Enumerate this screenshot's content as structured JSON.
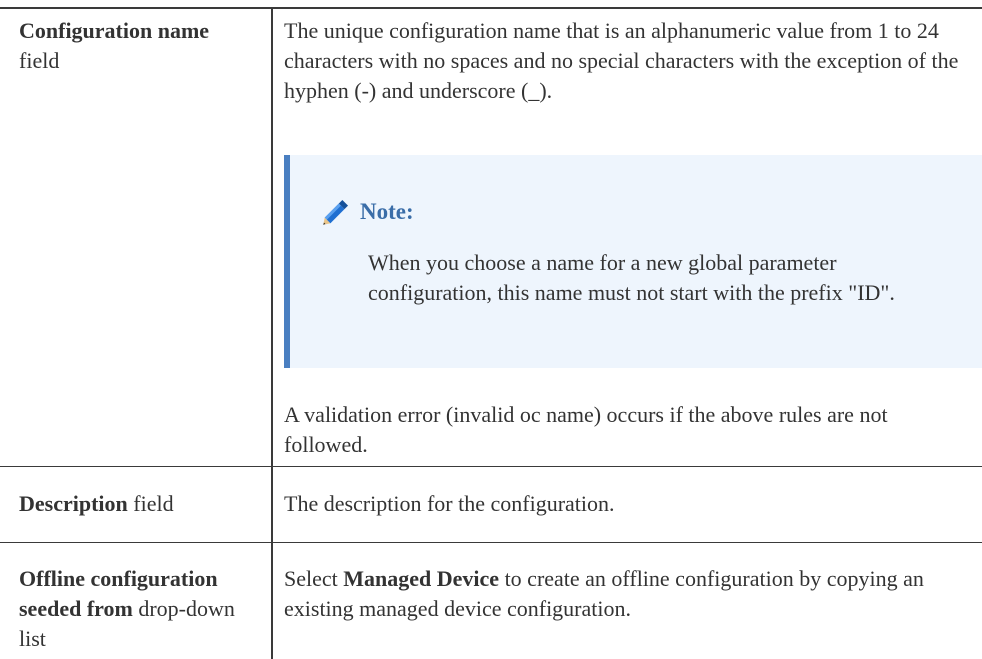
{
  "rows": [
    {
      "term_bold": "Configuration name",
      "term_rest": "field",
      "definition": "The unique configuration name that is an alphanumeric value from 1 to 24 characters with no spaces and no special characters with the exception of the hyphen (-) and underscore (_).",
      "note": {
        "icon": "pencil-icon",
        "title": "Note:",
        "text": "When you choose a name for a new global parameter configuration, this name must not start with the prefix \"ID\"."
      },
      "definition_after": "A validation error (invalid oc name) occurs if the above rules are not followed."
    },
    {
      "term_bold": "Description",
      "term_rest": "field",
      "definition": "The description for the configuration."
    },
    {
      "term_bold": "Offline configuration seeded from",
      "term_rest": "drop-down list",
      "definition_prefix": "Select",
      "definition_bold": "Managed Device",
      "definition_suffix": "to create an offline configuration by copying an existing managed device configuration."
    }
  ],
  "colors": {
    "note_background": "#eef5fd",
    "note_accent": "#4a7fc1",
    "note_title": "#3a6da8",
    "text": "#333333",
    "rules": "#3a3a3a"
  }
}
